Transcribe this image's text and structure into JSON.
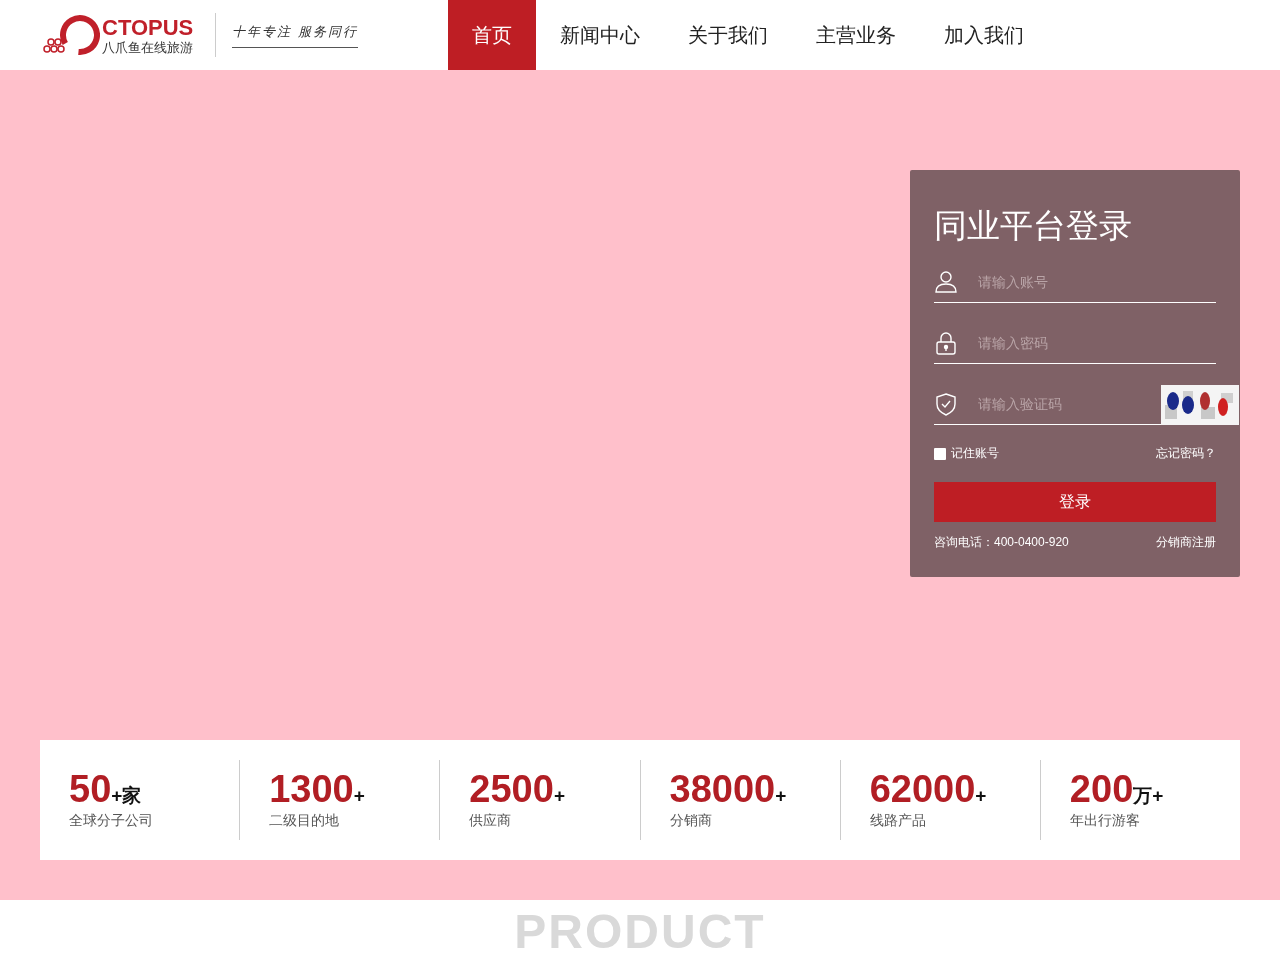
{
  "header": {
    "logo": {
      "wordmark": "CTOPUS",
      "subtitle": "八爪鱼在线旅游"
    },
    "slogan": "十年专注 服务同行"
  },
  "nav": [
    {
      "label": "首页",
      "selected": true
    },
    {
      "label": "新闻中心",
      "selected": false
    },
    {
      "label": "关于我们",
      "selected": false
    },
    {
      "label": "主营业务",
      "selected": false
    },
    {
      "label": "加入我们",
      "selected": false
    }
  ],
  "login": {
    "title": "同业平台登录",
    "fields": [
      {
        "kind": "user",
        "placeholder": "请输入账号"
      },
      {
        "kind": "password",
        "placeholder": "请输入密码"
      },
      {
        "kind": "captcha",
        "placeholder": "请输入验证码"
      }
    ],
    "remember": {
      "label": "记住账号",
      "checked": false
    },
    "forgot": "忘记密码？",
    "submit": "登录",
    "phone": "咨询电话：400-0400-920",
    "register": "分销商注册"
  },
  "stats": [
    {
      "number": "50",
      "unit": "+家",
      "label": "全球分子公司"
    },
    {
      "number": "1300",
      "unit": "+",
      "label": "二级目的地"
    },
    {
      "number": "2500",
      "unit": "+",
      "label": "供应商"
    },
    {
      "number": "38000",
      "unit": "+",
      "label": "分销商"
    },
    {
      "number": "62000",
      "unit": "+",
      "label": "线路产品"
    },
    {
      "number": "200",
      "unit": "万+",
      "label": "年出行游客"
    }
  ],
  "section_heading": "PRODUCT"
}
